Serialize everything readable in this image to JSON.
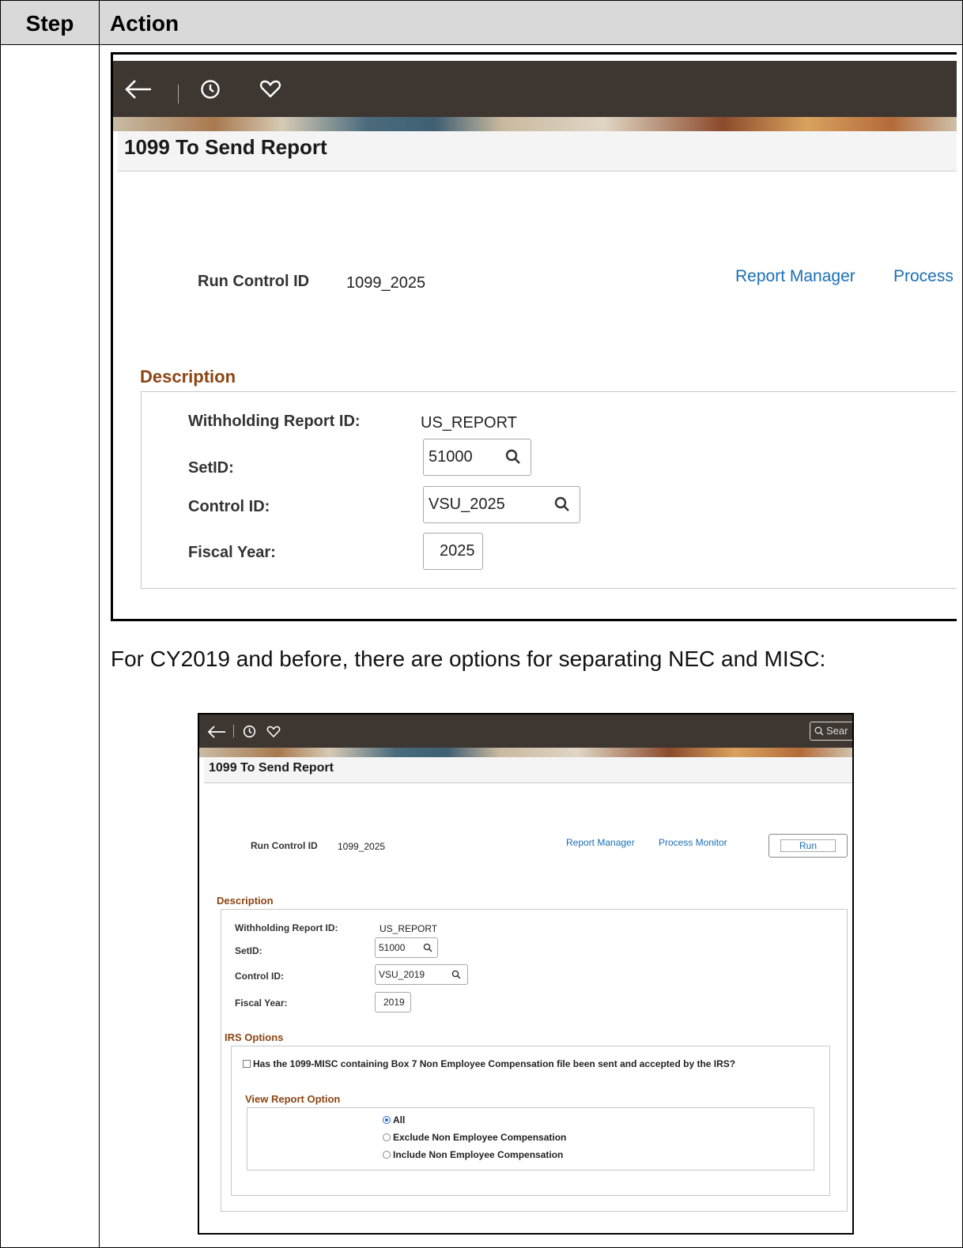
{
  "table": {
    "header_step": "Step",
    "header_action": "Action"
  },
  "screenshot1": {
    "page_title": "1099 To Send Report",
    "run_control_label": "Run Control ID",
    "run_control_value": "1099_2025",
    "link_report_manager": "Report Manager",
    "link_process": "Process",
    "section_description": "Description",
    "withholding_label": "Withholding Report ID:",
    "withholding_value": "US_REPORT",
    "setid_label": "SetID:",
    "setid_value": "51000",
    "control_id_label": "Control ID:",
    "control_id_value": "VSU_2025",
    "fiscal_year_label": "Fiscal Year:",
    "fiscal_year_value": "2025"
  },
  "caption": "For CY2019 and before, there are options for separating NEC and MISC:",
  "screenshot2": {
    "search_placeholder": "Sear",
    "page_title": "1099 To Send Report",
    "run_control_label": "Run Control ID",
    "run_control_value": "1099_2025",
    "link_report_manager": "Report Manager",
    "link_process_monitor": "Process Monitor",
    "run_button": "Run",
    "section_description": "Description",
    "withholding_label": "Withholding Report ID:",
    "withholding_value": "US_REPORT",
    "setid_label": "SetID:",
    "setid_value": "51000",
    "control_id_label": "Control ID:",
    "control_id_value": "VSU_2019",
    "fiscal_year_label": "Fiscal Year:",
    "fiscal_year_value": "2019",
    "section_irs_options": "IRS Options",
    "irs_checkbox_label": "Has the 1099-MISC containing Box 7 Non Employee Compensation file been sent and accepted by the IRS?",
    "irs_checkbox_checked": false,
    "section_view_report_option": "View Report Option",
    "radio_options": [
      "All",
      "Exclude Non Employee Compensation",
      "Include Non Employee Compensation"
    ],
    "radio_selected": "All"
  }
}
